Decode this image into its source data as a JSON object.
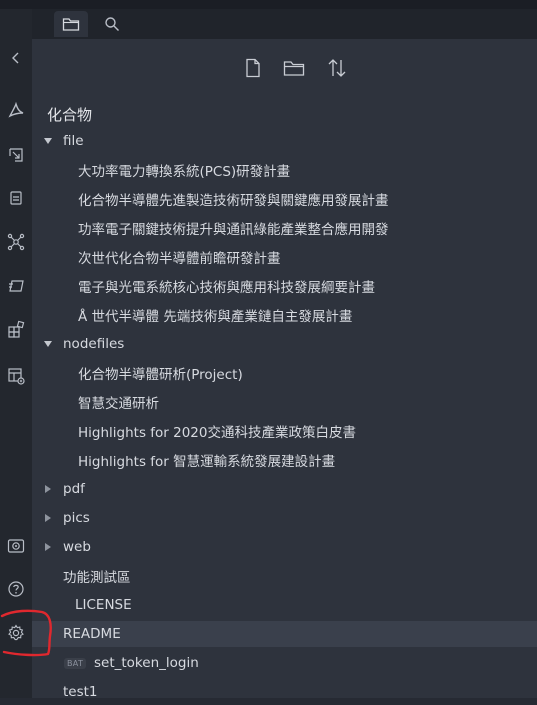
{
  "tabs": [
    {
      "icon": "folder-icon",
      "active": true
    },
    {
      "icon": "search-icon",
      "active": false
    }
  ],
  "ribbon": {
    "top_icons": [
      "chevron-left-icon",
      "pdf-icon",
      "canvas-icon",
      "calendar-icon",
      "graph-icon",
      "cards-icon",
      "plugins-icon",
      "table-icon"
    ],
    "bottom_icons": [
      "vault-icon",
      "help-icon",
      "settings-icon"
    ]
  },
  "toolbar": {
    "buttons": [
      "new-note-icon",
      "new-folder-icon",
      "sort-icon"
    ]
  },
  "vault": {
    "name": "化合物"
  },
  "tree": {
    "file": {
      "label": "file",
      "expanded": true,
      "children": [
        "大功率電力轉換系統(PCS)研發計畫",
        "化合物半導體先進製造技術研發與關鍵應用發展計畫",
        "功率電子關鍵技術提升與通訊綠能產業整合應用開發",
        "次世代化合物半導體前瞻研發計畫",
        "電子與光電系統核心技術與應用科技發展綱要計畫",
        "Å 世代半導體 先端技術與產業鏈自主發展計畫"
      ]
    },
    "nodefiles": {
      "label": "nodefiles",
      "expanded": true,
      "children": [
        "化合物半導體研析(Project)",
        "智慧交通研析",
        "Highlights for 2020交通科技產業政策白皮書",
        "Highlights for 智慧運輸系統發展建設計畫"
      ]
    },
    "collapsed_folders": [
      "pdf",
      "pics",
      "web"
    ],
    "root_items": {
      "test_area": "功能測試區",
      "license": "LICENSE",
      "readme": "README",
      "bat_badge": "BAT",
      "set_token_login": "set_token_login",
      "test1": "test1"
    }
  },
  "colors": {
    "panel_bg": "#2e333d",
    "ribbon_bg": "#23272e",
    "selected_row": "#3a404c",
    "annotation_red": "#e0282e"
  }
}
